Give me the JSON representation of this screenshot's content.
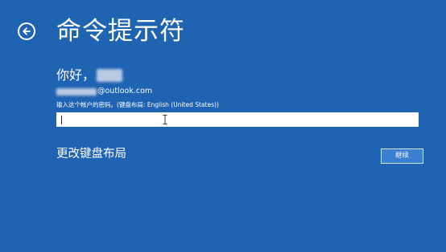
{
  "header": {
    "title": "命令提示符",
    "back_icon": "back-arrow-circle-icon"
  },
  "account": {
    "greeting": "你好，",
    "email_domain": "@outlook.com"
  },
  "password": {
    "prompt": "输入这个帐户的密码。(键盘布局: English (United States))",
    "value": ""
  },
  "actions": {
    "change_keyboard_layout": "更改键盘布局",
    "continue_label": "继续"
  },
  "colors": {
    "background": "#1f63b3",
    "button_fill": "#3b7fd0",
    "text": "#ffffff"
  }
}
